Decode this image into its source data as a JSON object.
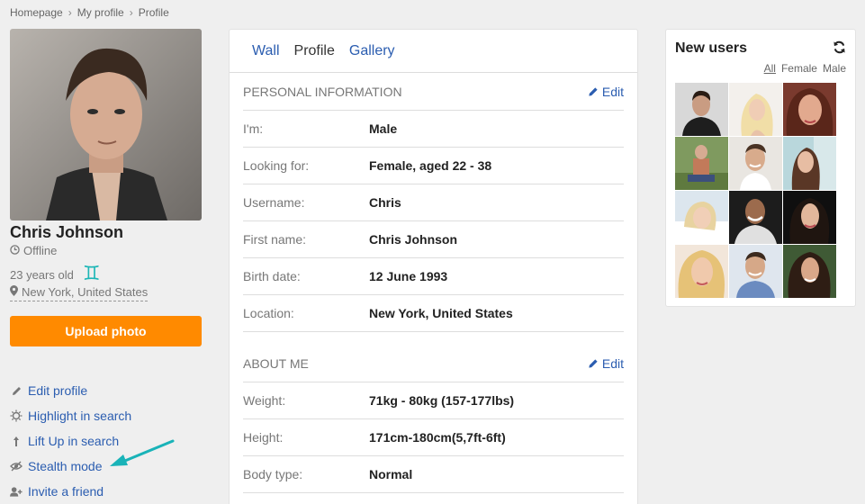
{
  "breadcrumb": {
    "items": [
      "Homepage",
      "My profile",
      "Profile"
    ],
    "separator": "›"
  },
  "profile": {
    "name": "Chris Johnson",
    "status": "Offline",
    "age": "23 years old",
    "zodiac_symbol": "♊",
    "location": "New York, United States",
    "upload_label": "Upload photo"
  },
  "actions": [
    {
      "label": "Edit profile",
      "icon": "pencil-icon"
    },
    {
      "label": "Highlight in search",
      "icon": "sun-icon"
    },
    {
      "label": "Lift Up in search",
      "icon": "lift-up-icon"
    },
    {
      "label": "Stealth mode",
      "icon": "eye-slash-icon"
    },
    {
      "label": "Invite a friend",
      "icon": "add-user-icon"
    }
  ],
  "tabs": [
    {
      "label": "Wall",
      "active": false
    },
    {
      "label": "Profile",
      "active": true
    },
    {
      "label": "Gallery",
      "active": false
    }
  ],
  "personal": {
    "title": "PERSONAL INFORMATION",
    "edit_label": "Edit",
    "rows": [
      {
        "label": "I'm:",
        "value": "Male"
      },
      {
        "label": "Looking for:",
        "value": "Female, aged 22 - 38"
      },
      {
        "label": "Username:",
        "value": "Chris"
      },
      {
        "label": "First name:",
        "value": "Chris Johnson"
      },
      {
        "label": "Birth date:",
        "value": "12 June 1993"
      },
      {
        "label": "Location:",
        "value": "New York, United States"
      }
    ]
  },
  "about": {
    "title": "ABOUT ME",
    "edit_label": "Edit",
    "rows": [
      {
        "label": "Weight:",
        "value": "71kg - 80kg (157-177lbs)"
      },
      {
        "label": "Height:",
        "value": "171cm-180cm(5,7ft-6ft)"
      },
      {
        "label": "Body type:",
        "value": "Normal"
      }
    ]
  },
  "new_users": {
    "title": "New users",
    "filters": [
      "All",
      "Female",
      "Male"
    ],
    "selected_filter": "All",
    "thumb_count": 12
  },
  "colors": {
    "accent": "#ff8a00",
    "link": "#2b5db0",
    "zodiac": "#1cb6b6",
    "arrow": "#19b3b8"
  }
}
